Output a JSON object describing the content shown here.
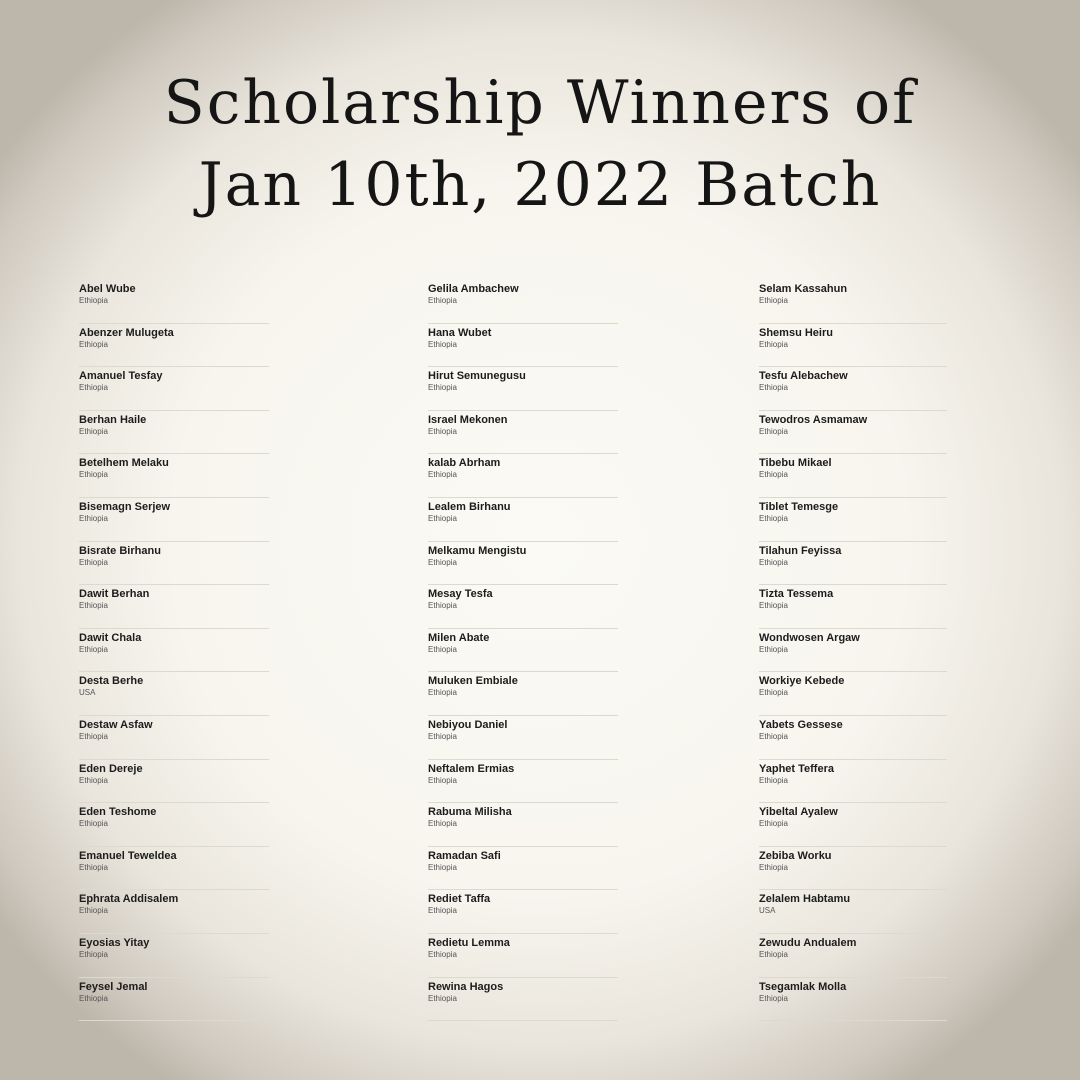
{
  "title": {
    "line1": "Scholarship Winners of",
    "line2": "Jan 10th, 2022 Batch"
  },
  "columns": [
    [
      {
        "name": "Abel Wube",
        "country": "Ethiopia"
      },
      {
        "name": "Abenzer Mulugeta",
        "country": "Ethiopia"
      },
      {
        "name": "Amanuel Tesfay",
        "country": "Ethiopia"
      },
      {
        "name": "Berhan Haile",
        "country": "Ethiopia"
      },
      {
        "name": "Betelhem Melaku",
        "country": "Ethiopia"
      },
      {
        "name": "Bisemagn Serjew",
        "country": "Ethiopia"
      },
      {
        "name": "Bisrate Birhanu",
        "country": "Ethiopia"
      },
      {
        "name": "Dawit Berhan",
        "country": "Ethiopia"
      },
      {
        "name": "Dawit Chala",
        "country": "Ethiopia"
      },
      {
        "name": "Desta Berhe",
        "country": "USA"
      },
      {
        "name": "Destaw Asfaw",
        "country": "Ethiopia"
      },
      {
        "name": "Eden Dereje",
        "country": "Ethiopia"
      },
      {
        "name": "Eden Teshome",
        "country": "Ethiopia"
      },
      {
        "name": "Emanuel Teweldea",
        "country": "Ethiopia"
      },
      {
        "name": "Ephrata Addisalem",
        "country": "Ethiopia"
      },
      {
        "name": "Eyosias Yitay",
        "country": "Ethiopia"
      },
      {
        "name": "Feysel Jemal",
        "country": "Ethiopia"
      }
    ],
    [
      {
        "name": "Gelila Ambachew",
        "country": "Ethiopia"
      },
      {
        "name": "Hana Wubet",
        "country": "Ethiopia"
      },
      {
        "name": "Hirut Semunegusu",
        "country": "Ethiopia"
      },
      {
        "name": "Israel Mekonen",
        "country": "Ethiopia"
      },
      {
        "name": "kalab Abrham",
        "country": "Ethiopia"
      },
      {
        "name": "Lealem Birhanu",
        "country": "Ethiopia"
      },
      {
        "name": "Melkamu Mengistu",
        "country": "Ethiopia"
      },
      {
        "name": "Mesay Tesfa",
        "country": "Ethiopia"
      },
      {
        "name": "Milen Abate",
        "country": "Ethiopia"
      },
      {
        "name": "Muluken Embiale",
        "country": "Ethiopia"
      },
      {
        "name": "Nebiyou Daniel",
        "country": "Ethiopia"
      },
      {
        "name": "Neftalem Ermias",
        "country": "Ethiopia"
      },
      {
        "name": "Rabuma Milisha",
        "country": "Ethiopia"
      },
      {
        "name": "Ramadan Safi",
        "country": "Ethiopia"
      },
      {
        "name": "Rediet Taffa",
        "country": "Ethiopia"
      },
      {
        "name": "Redietu Lemma",
        "country": "Ethiopia"
      },
      {
        "name": "Rewina Hagos",
        "country": "Ethiopia"
      }
    ],
    [
      {
        "name": "Selam Kassahun",
        "country": "Ethiopia"
      },
      {
        "name": "Shemsu Heiru",
        "country": "Ethiopia"
      },
      {
        "name": "Tesfu Alebachew",
        "country": "Ethiopia"
      },
      {
        "name": "Tewodros Asmamaw",
        "country": "Ethiopia"
      },
      {
        "name": "Tibebu Mikael",
        "country": "Ethiopia"
      },
      {
        "name": "Tiblet Temesge",
        "country": "Ethiopia"
      },
      {
        "name": "Tilahun Feyissa",
        "country": "Ethiopia"
      },
      {
        "name": "Tizta Tessema",
        "country": "Ethiopia"
      },
      {
        "name": "Wondwosen Argaw",
        "country": "Ethiopia"
      },
      {
        "name": "Workiye Kebede",
        "country": "Ethiopia"
      },
      {
        "name": "Yabets Gessese",
        "country": "Ethiopia"
      },
      {
        "name": "Yaphet Teffera",
        "country": "Ethiopia"
      },
      {
        "name": "Yibeltal Ayalew",
        "country": "Ethiopia"
      },
      {
        "name": "Zebiba Worku",
        "country": "Ethiopia"
      },
      {
        "name": "Zelalem Habtamu",
        "country": "USA"
      },
      {
        "name": "Zewudu Andualem",
        "country": "Ethiopia"
      },
      {
        "name": "Tsegamlak Molla",
        "country": "Ethiopia"
      }
    ]
  ]
}
